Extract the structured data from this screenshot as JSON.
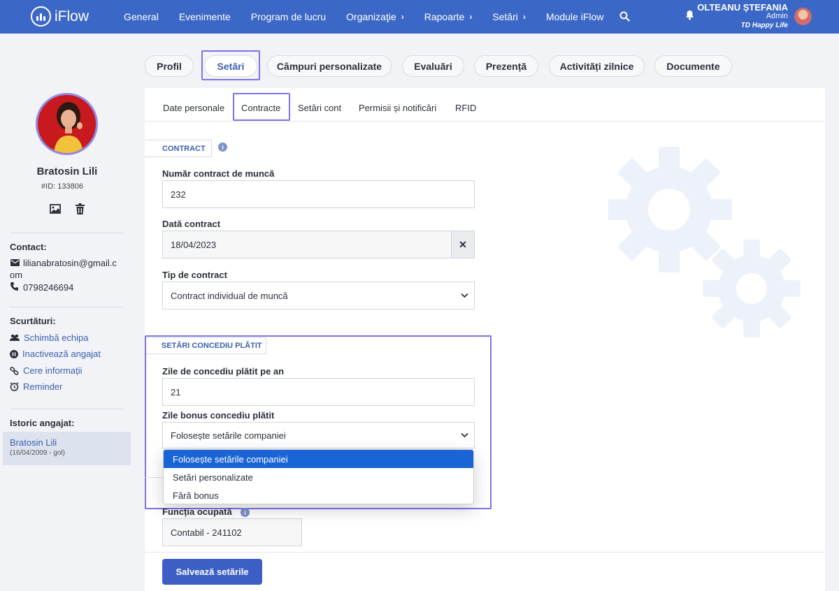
{
  "app": {
    "name": "iFlow"
  },
  "nav": {
    "items": [
      {
        "label": "General"
      },
      {
        "label": "Evenimente"
      },
      {
        "label": "Program de lucru"
      },
      {
        "label": "Organizaţie"
      },
      {
        "label": "Rapoarte"
      },
      {
        "label": "Setări"
      },
      {
        "label": "Module iFlow"
      }
    ]
  },
  "user": {
    "name": "OLTEANU ȘTEFANIA",
    "role": "Admin",
    "company": "TD Happy Life"
  },
  "tabs": [
    {
      "label": "Profil"
    },
    {
      "label": "Setări"
    },
    {
      "label": "Câmpuri personalizate"
    },
    {
      "label": "Evaluări"
    },
    {
      "label": "Prezență"
    },
    {
      "label": "Activități zilnice"
    },
    {
      "label": "Documente"
    }
  ],
  "subtabs": [
    {
      "label": "Date personale"
    },
    {
      "label": "Contracte"
    },
    {
      "label": "Setări cont"
    },
    {
      "label": "Permisii și notificări"
    },
    {
      "label": "RFID"
    }
  ],
  "contract": {
    "title": "CONTRACT",
    "number_label": "Număr contract de muncă",
    "number_value": "232",
    "date_label": "Dată contract",
    "date_value": "18/04/2023",
    "type_label": "Tip de contract",
    "type_value": "Contract individual de muncă"
  },
  "leave": {
    "title": "SETĂRI CONCEDIU PLĂTIT",
    "days_label": "Zile de concediu plătit pe an",
    "days_value": "21",
    "bonus_label": "Zile bonus concediu plătit",
    "bonus_value": "Folosește setările companiei",
    "options": [
      "Folosește setările companiei",
      "Setări personalizate",
      "Fără bonus"
    ]
  },
  "job": {
    "label": "Funcția ocupată",
    "value": "Contabil - 241102"
  },
  "save_label": "Salvează setările",
  "profile": {
    "name": "Bratosin Lili",
    "id": "#ID: 133806",
    "contact_heading": "Contact:",
    "email_line1": "lilianabratosin@gmail.c",
    "email_line2": "om",
    "phone": "0798246694",
    "shortcuts_heading": "Scurtături:",
    "shortcuts": [
      "Schimbă echipa",
      "Inactivează angajat",
      "Cere informații",
      "Reminder"
    ],
    "history_heading": "Istoric angajat:",
    "history_name": "Bratosin Lili",
    "history_period": "(16/04/2009 - gol)"
  },
  "colors": {
    "brand": "#3b68c7",
    "highlight": "#7b74e8",
    "link": "#3b5fae",
    "selected_option": "#1a65d6"
  }
}
